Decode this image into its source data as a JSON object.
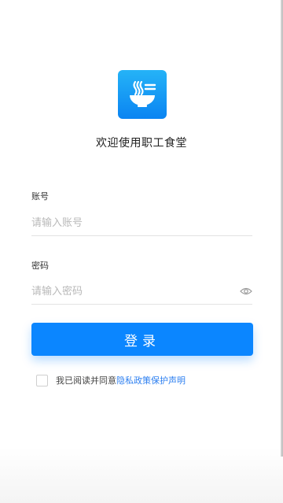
{
  "app": {
    "title": "欢迎使用职工食堂",
    "logo_icon": "noodle-bowl-icon",
    "brand_color": "#0b86ff"
  },
  "account": {
    "label": "账号",
    "placeholder": "请输入账号",
    "value": ""
  },
  "password": {
    "label": "密码",
    "placeholder": "请输入密码",
    "value": "",
    "toggle_icon": "eye-icon"
  },
  "login_button": {
    "label": "登录"
  },
  "agreement": {
    "checked": false,
    "text": "我已阅读并同意",
    "link_text": "隐私政策保护声明",
    "link_color": "#2d7ff0"
  }
}
